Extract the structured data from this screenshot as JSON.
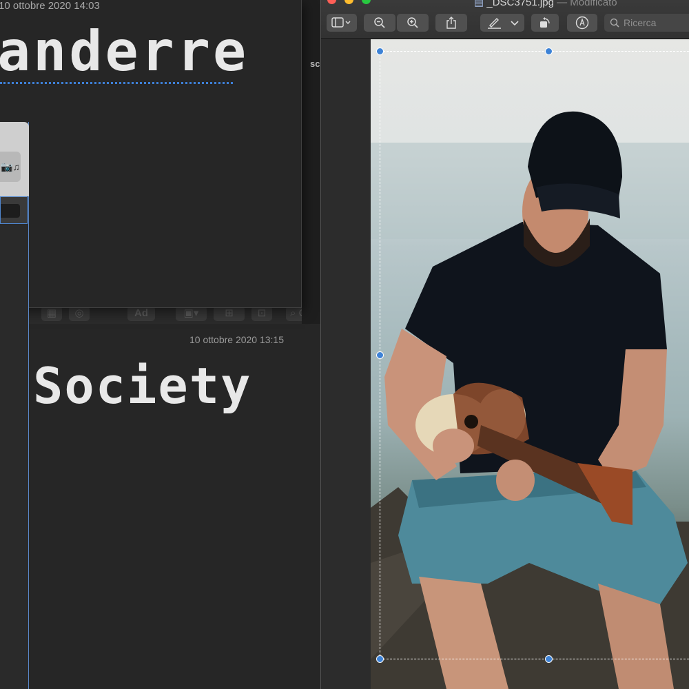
{
  "notes": {
    "front": {
      "date": "10 ottobre 2020 14:03",
      "title": "anderre"
    },
    "back": {
      "date": "10 ottobre 2020 13:15",
      "title": "Society",
      "toolbar_ad": "Ad",
      "toolbar_search": "Ce"
    }
  },
  "mid_strip": {
    "caption": "sc"
  },
  "preview": {
    "file_name": "_DSC3751.jpg",
    "separator": " — ",
    "status": "Modificato",
    "search_placeholder": "Ricerca",
    "colors": {
      "close": "#ff5f57",
      "minimize": "#febc2e",
      "zoom": "#28c840",
      "handle": "#3d82d6"
    },
    "icons": [
      "sidebar-icon",
      "zoom-out-icon",
      "zoom-in-icon",
      "share-icon",
      "markup-pen-icon",
      "rotate-icon",
      "annotate-icon",
      "search-icon"
    ]
  }
}
